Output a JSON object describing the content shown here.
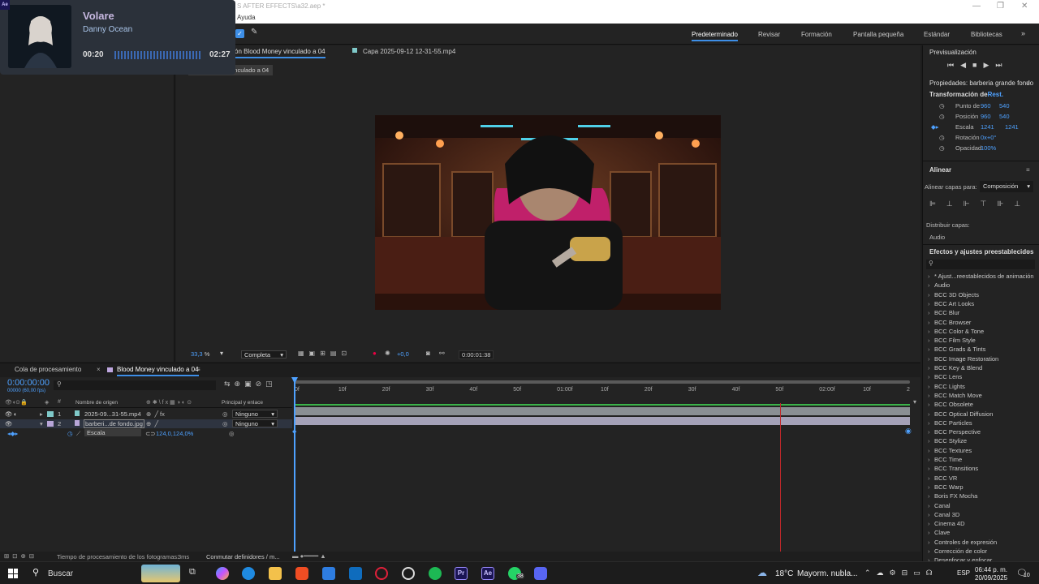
{
  "window": {
    "title_partial": "S AFTER EFFECTS\\a32.aep *",
    "menu_item_partial": "Ayuda",
    "app_icon": "Ae"
  },
  "workspaces": [
    "Predeterminado",
    "Revisar",
    "Formación",
    "Pantalla pequeña",
    "Estándar",
    "Bibliotecas"
  ],
  "composition_tabs": {
    "active_partial": "ón Blood Money vinculado a 04",
    "footage": "Capa 2025-09-12 12-31-55.mp4",
    "breadcrumb": "Blood Money vinculado a 04"
  },
  "viewer": {
    "zoom": "33,3",
    "zoom_unit": "%",
    "resolution": "Completa",
    "exposure": "+0,0",
    "timecode": "0:00:01:38"
  },
  "music_overlay": {
    "song": "Volare",
    "artist": "Danny Ocean",
    "elapsed": "00:20",
    "duration": "02:27"
  },
  "preview": {
    "title": "Previsualización"
  },
  "properties": {
    "title": "Propiedades: barberia grande fondo",
    "section": "Transformación de",
    "reset": "Rest.",
    "rows": [
      {
        "label": "Punto de",
        "v1": "960",
        "v2": "540"
      },
      {
        "label": "Posición",
        "v1": "960",
        "v2": "540"
      },
      {
        "label": "Escala",
        "v1": "1241",
        "v2": "1241"
      },
      {
        "label": "Rotación",
        "v1": "0x+0°",
        "v2": ""
      },
      {
        "label": "Opacidad",
        "v1": "100%",
        "v2": ""
      }
    ]
  },
  "align": {
    "title": "Alinear",
    "align_to_label": "Alinear capas para:",
    "align_to_value": "Composición",
    "distribute_label": "Distribuir capas:",
    "audio": "Audio"
  },
  "effects": {
    "title": "Efectos y ajustes preestablecidos",
    "search_placeholder": "",
    "items": [
      "* Ajust...reestablecidos de animación",
      "Audio",
      "BCC 3D Objects",
      "BCC Art Looks",
      "BCC Blur",
      "BCC Browser",
      "BCC Color & Tone",
      "BCC Film Style",
      "BCC Grads & Tints",
      "BCC Image Restoration",
      "BCC Key & Blend",
      "BCC Lens",
      "BCC Lights",
      "BCC Match Move",
      "BCC Obsolete",
      "BCC Optical Diffusion",
      "BCC Particles",
      "BCC Perspective",
      "BCC Stylize",
      "BCC Textures",
      "BCC Time",
      "BCC Transitions",
      "BCC VR",
      "BCC Warp",
      "Boris FX Mocha",
      "Canal",
      "Canal 3D",
      "Cinema 4D",
      "Clave",
      "Controles de expresión",
      "Corrección de color",
      "Desenfocar y enfocar"
    ]
  },
  "timeline": {
    "tab_queue": "Cola de procesamiento",
    "tab_comp": "Blood Money vinculado a 04",
    "current_time": "0:00:00:00",
    "frame_info": "00000 (60,00 fps)",
    "col_source": "Nombre de origen",
    "col_parent": "Principal y enlace",
    "col_hash": "#",
    "ruler": [
      "0f",
      "10f",
      "20f",
      "30f",
      "40f",
      "50f",
      "01:00f",
      "10f",
      "20f",
      "30f",
      "40f",
      "50f",
      "02:00f",
      "10f",
      "2"
    ],
    "layers": [
      {
        "num": "1",
        "name": "2025-09...31-55.mp4",
        "parent": "Ninguno"
      },
      {
        "num": "2",
        "name": "barberi...de fondo.jpg",
        "parent": "Ninguno"
      }
    ],
    "sub_property": {
      "name": "Escala",
      "value": "124,0,124,0%"
    }
  },
  "status": {
    "render_time_label": "Tiempo de procesamiento de los fotogramas:",
    "render_time_value": "3ms",
    "toggle": "Conmutar definidores / m..."
  },
  "taskbar": {
    "search": "Buscar",
    "weather_temp": "18°C",
    "weather_desc": "Mayorm. nubla...",
    "lang": "ESP",
    "time": "06:44 p. m.",
    "date": "20/09/2025",
    "whatsapp_badge": "38",
    "notif_badge": "10"
  }
}
